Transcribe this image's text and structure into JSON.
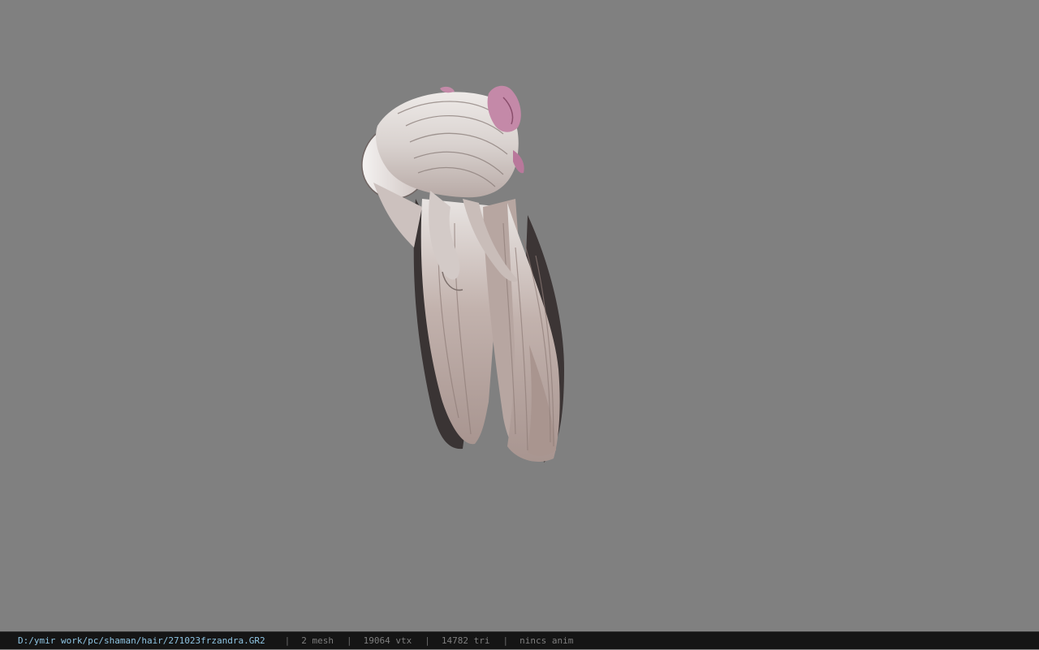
{
  "viewer": {
    "background_color": "#808080",
    "model_icon": "hair-model-preview"
  },
  "status_bar": {
    "file_path": "D:/ymir work/pc/shaman/hair/271023frzandra.GR2",
    "mesh_count": "2 mesh",
    "vertex_count": "19064 vtx",
    "triangle_count": "14782 tri",
    "animation": "nincs anim",
    "separator": "|",
    "path_color": "#8ec4e2",
    "text_color": "#7e7e7e"
  }
}
